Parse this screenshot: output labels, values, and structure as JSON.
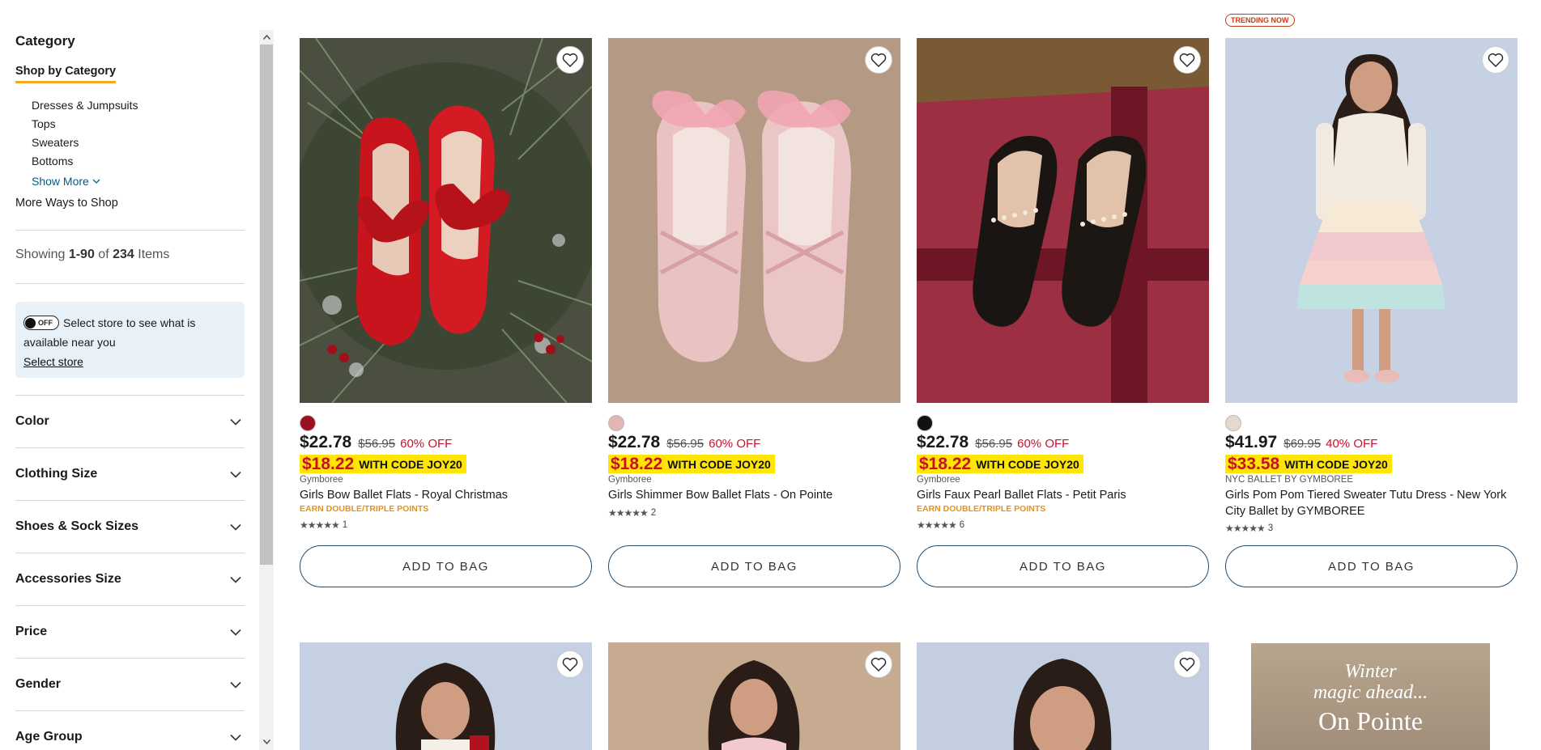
{
  "sidebar": {
    "title": "Category",
    "shop_by": "Shop by Category",
    "categories": [
      "Dresses & Jumpsuits",
      "Tops",
      "Sweaters",
      "Bottoms"
    ],
    "show_more": "Show More",
    "more_ways": "More Ways to Shop",
    "showing_prefix": "Showing ",
    "showing_range": "1-90",
    "showing_of": " of ",
    "showing_total": "234",
    "showing_suffix": " Items",
    "store": {
      "toggle_label": "OFF",
      "message": "Select store to see what is available near you",
      "link": "Select store"
    },
    "facets": [
      "Color",
      "Clothing Size",
      "Shoes & Sock Sizes",
      "Accessories Size",
      "Price",
      "Gender",
      "Age Group"
    ]
  },
  "products": [
    {
      "swatch": "#9b1020",
      "price": "$22.78",
      "was": "$56.95",
      "off": "60% OFF",
      "promo_price": "$18.22",
      "promo_code": "WITH CODE JOY20",
      "brand": "Gymboree",
      "name": "Girls Bow Ballet Flats - Royal Christmas",
      "points": "EARN DOUBLE/TRIPLE POINTS",
      "stars": "★★★★★",
      "reviews": "1",
      "add": "ADD TO BAG"
    },
    {
      "swatch": "#e2b7b3",
      "price": "$22.78",
      "was": "$56.95",
      "off": "60% OFF",
      "promo_price": "$18.22",
      "promo_code": "WITH CODE JOY20",
      "brand": "Gymboree",
      "name": "Girls Shimmer Bow Ballet Flats - On Pointe",
      "points": "",
      "stars": "★★★★★",
      "reviews": "2",
      "add": "ADD TO BAG"
    },
    {
      "swatch": "#111111",
      "price": "$22.78",
      "was": "$56.95",
      "off": "60% OFF",
      "promo_price": "$18.22",
      "promo_code": "WITH CODE JOY20",
      "brand": "Gymboree",
      "name": "Girls Faux Pearl Ballet Flats - Petit Paris",
      "points": "EARN DOUBLE/TRIPLE POINTS",
      "stars": "★★★★★",
      "reviews": "6",
      "add": "ADD TO BAG"
    },
    {
      "badge": "TRENDING NOW",
      "swatch": "#e6d9cc",
      "price": "$41.97",
      "was": "$69.95",
      "off": "40% OFF",
      "promo_price": "$33.58",
      "promo_code": "WITH CODE JOY20",
      "brand": "NYC BALLET BY GYMBOREE",
      "name": "Girls Pom Pom Tiered Sweater Tutu Dress - New York City Ballet by GYMBOREE",
      "points": "",
      "stars": "★★★★★",
      "reviews": "3",
      "add": "ADD TO BAG"
    }
  ],
  "banner": {
    "line1": "Winter\nmagic ahead...",
    "line2": "On Pointe"
  },
  "colors": {
    "accent_underline": "#f5a623",
    "sale_red": "#c8102e",
    "promo_yellow": "#ffe500",
    "button_border": "#1f4d73",
    "store_box": "#e8f1f8"
  }
}
